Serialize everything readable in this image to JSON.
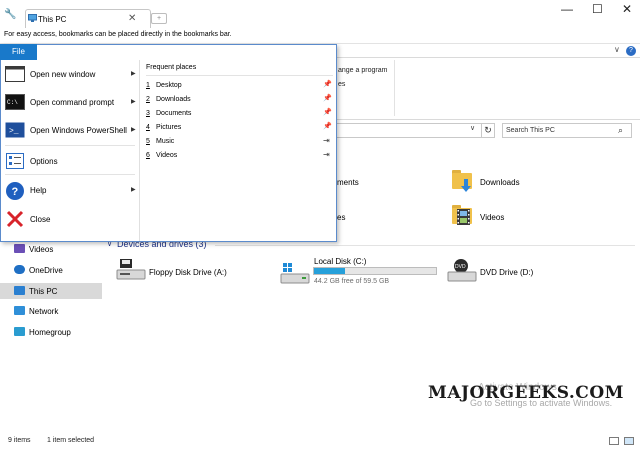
{
  "browser": {
    "tab_title": "This PC",
    "bookmarks_hint": "For easy access, bookmarks can be placed directly in the bookmarks bar.",
    "min": "—",
    "max": "☐",
    "close": "✕"
  },
  "ribbon": {
    "file_tab": "File",
    "change_program_fragment": "ange a program",
    "es_fragment": "es"
  },
  "address": {
    "search_placeholder": "Search This PC"
  },
  "file_menu": {
    "items": [
      {
        "label": "Open new window",
        "has_submenu": true
      },
      {
        "label": "Open command prompt",
        "has_submenu": true
      },
      {
        "label": "Open Windows PowerShell",
        "has_submenu": true
      },
      {
        "label": "Options",
        "has_submenu": false
      },
      {
        "label": "Help",
        "has_submenu": true
      },
      {
        "label": "Close",
        "has_submenu": false
      }
    ],
    "frequent_title": "Frequent places",
    "frequent": [
      {
        "num": "1",
        "label": "Desktop",
        "pin": "pinned"
      },
      {
        "num": "2",
        "label": "Downloads",
        "pin": "pinned"
      },
      {
        "num": "3",
        "label": "Documents",
        "pin": "pinned"
      },
      {
        "num": "4",
        "label": "Pictures",
        "pin": "pinned"
      },
      {
        "num": "5",
        "label": "Music",
        "pin": "unpinned"
      },
      {
        "num": "6",
        "label": "Videos",
        "pin": "unpinned"
      }
    ]
  },
  "nav": {
    "items": [
      {
        "label": "Videos",
        "icon": "videos-icon",
        "selected": false
      },
      {
        "label": "OneDrive",
        "icon": "onedrive-icon",
        "selected": false
      },
      {
        "label": "This PC",
        "icon": "this-pc-icon",
        "selected": true
      },
      {
        "label": "Network",
        "icon": "network-icon",
        "selected": false
      },
      {
        "label": "Homegroup",
        "icon": "homegroup-icon",
        "selected": false
      }
    ]
  },
  "folders": {
    "documents_fragment": "ments",
    "pictures_fragment": "es",
    "downloads": "Downloads",
    "videos": "Videos"
  },
  "devices": {
    "header": "Devices and drives (3)",
    "floppy": "Floppy Disk Drive (A:)",
    "local_disk": "Local Disk (C:)",
    "local_disk_free": "44.2 GB free of 59.5 GB",
    "local_disk_used_fraction": 0.257,
    "dvd": "DVD Drive (D:)"
  },
  "status": {
    "items": "9 items",
    "selected": "1 item selected"
  },
  "overlay": {
    "watermark": "MAJORGEEKS.COM",
    "activate_title": "Activate Windows",
    "activate_sub": "Go to Settings to activate Windows."
  },
  "colors": {
    "accent": "#1979ca",
    "selection": "#d9d9d9",
    "progress": "#26a0da",
    "section_header": "#1e3287"
  }
}
